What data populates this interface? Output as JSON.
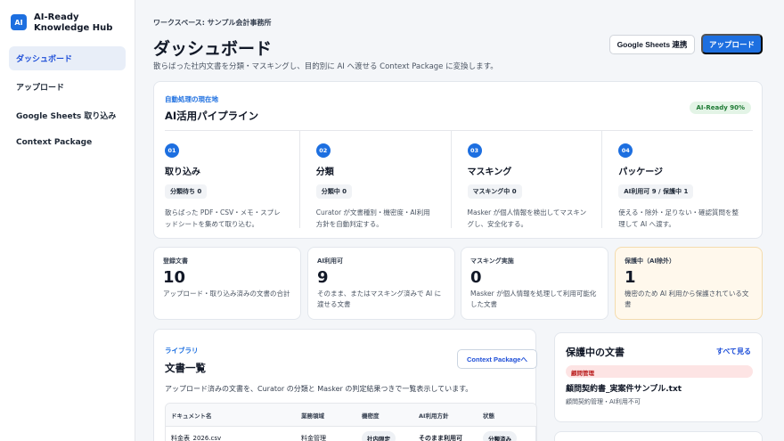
{
  "sidebar": {
    "logo": "AI",
    "brand": "AI-Ready Knowledge Hub",
    "items": [
      {
        "label": "ダッシュボード",
        "active": true
      },
      {
        "label": "アップロード"
      },
      {
        "label": "Google Sheets 取り込み"
      },
      {
        "label": "Context Package"
      }
    ]
  },
  "header": {
    "workspace": "ワークスペース: サンプル会計事務所",
    "title": "ダッシュボード",
    "description": "散らばった社内文書を分類・マスキングし、目的別に AI へ渡せる Context Package に変換します。",
    "sheets_button": "Google Sheets 連携",
    "upload_button": "アップロード"
  },
  "pipeline": {
    "eyebrow": "自動処理の現在地",
    "title": "AI活用パイプライン",
    "badge": "AI-Ready 90%",
    "stages": [
      {
        "num": "01",
        "name": "取り込み",
        "badge": "分類待ち 0",
        "desc": "散らばった PDF・CSV・メモ・スプレッドシートを集めて取り込む。"
      },
      {
        "num": "02",
        "name": "分類",
        "badge": "分類中 0",
        "desc": "Curator が文書種別・機密度・AI利用方針を自動判定する。"
      },
      {
        "num": "03",
        "name": "マスキング",
        "badge": "マスキング中 0",
        "desc": "Masker が個人情報を検出してマスキングし、安全化する。"
      },
      {
        "num": "04",
        "name": "パッケージ",
        "badge": "AI利用可 9 / 保護中 1",
        "desc": "使える・除外・足りない・確認質問を整理して AI へ渡す。"
      }
    ]
  },
  "stats": [
    {
      "label": "登録文書",
      "value": "10",
      "note": "アップロード・取り込み済みの文書の合計"
    },
    {
      "label": "AI利用可",
      "value": "9",
      "note": "そのまま、またはマスキング済みで AI に渡せる文書"
    },
    {
      "label": "マスキング実施",
      "value": "0",
      "note": "Masker が個人情報を処理して利用可能化した文書"
    },
    {
      "label": "保護中（AI除外）",
      "value": "1",
      "note": "機密のため AI 利用から保護されている文書"
    }
  ],
  "documents": {
    "eyebrow": "ライブラリ",
    "title": "文書一覧",
    "button": "Context Packageへ",
    "description": "アップロード済みの文書を、Curator の分類と Masker の判定結果つきで一覧表示しています。",
    "columns": [
      "ドキュメント名",
      "業務領域",
      "機密度",
      "AI利用方針",
      "状態"
    ],
    "rows": [
      {
        "name": "料金表_2026.csv",
        "domain": "料金管理",
        "sensitivity": "社内限定",
        "policy": "そのまま利用可",
        "status": "分類済み"
      }
    ]
  },
  "protected": {
    "title": "保護中の文書",
    "link": "すべて見る",
    "badge": "顧問管理",
    "file": "顧問契約書_実案件サンプル.txt",
    "meta": "顧問契約管理・AI利用不可"
  },
  "colors": {
    "accent": "#1d6fe0",
    "ready": "#1e7a34",
    "danger": "#b91c1c"
  }
}
